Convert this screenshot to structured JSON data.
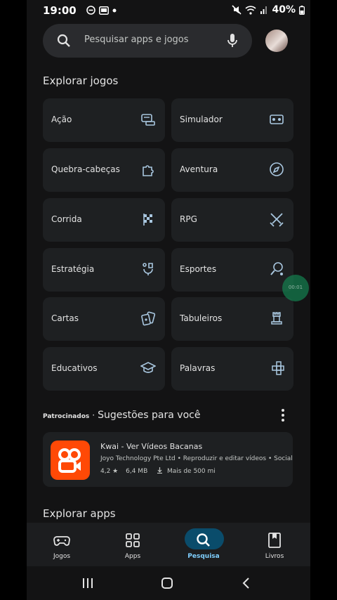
{
  "status_bar": {
    "time": "19:00",
    "battery": "40%"
  },
  "search": {
    "placeholder": "Pesquisar apps e jogos"
  },
  "explore_games": {
    "heading": "Explorar jogos",
    "categories": [
      {
        "label": "Ação",
        "icon": "controller-icon"
      },
      {
        "label": "Simulador",
        "icon": "simulator-icon"
      },
      {
        "label": "Quebra-cabeças",
        "icon": "puzzle-icon"
      },
      {
        "label": "Aventura",
        "icon": "compass-icon"
      },
      {
        "label": "Corrida",
        "icon": "checkered-flag-icon"
      },
      {
        "label": "RPG",
        "icon": "swords-icon"
      },
      {
        "label": "Estratégia",
        "icon": "strategy-icon"
      },
      {
        "label": "Esportes",
        "icon": "sports-icon"
      },
      {
        "label": "Cartas",
        "icon": "cards-icon"
      },
      {
        "label": "Tabuleiros",
        "icon": "chess-rook-icon"
      },
      {
        "label": "Educativos",
        "icon": "graduation-cap-icon"
      },
      {
        "label": "Palavras",
        "icon": "word-tiles-icon"
      }
    ]
  },
  "suggestions": {
    "sponsored_tag": "Patrocinados",
    "separator": "·",
    "title": "Sugestões para você",
    "app": {
      "title": "Kwai - Ver Vídeos Bacanas",
      "subtitle": "Joyo Technology Pte Ltd • Reproduzir e editar vídeos • Social",
      "rating": "4,2 ★",
      "size": "6,4 MB",
      "downloads": "Mais de 500 mi"
    }
  },
  "explore_apps": {
    "heading": "Explorar apps"
  },
  "bottom_nav": [
    {
      "label": "Jogos",
      "icon": "gamepad-icon",
      "active": false
    },
    {
      "label": "Apps",
      "icon": "apps-grid-icon",
      "active": false
    },
    {
      "label": "Pesquisa",
      "icon": "search-icon",
      "active": true
    },
    {
      "label": "Livros",
      "icon": "bookmark-book-icon",
      "active": false
    }
  ],
  "colors": {
    "accent": "#7fcfff",
    "active_pill": "#0a4c6b",
    "kwai": "#ff4906"
  }
}
